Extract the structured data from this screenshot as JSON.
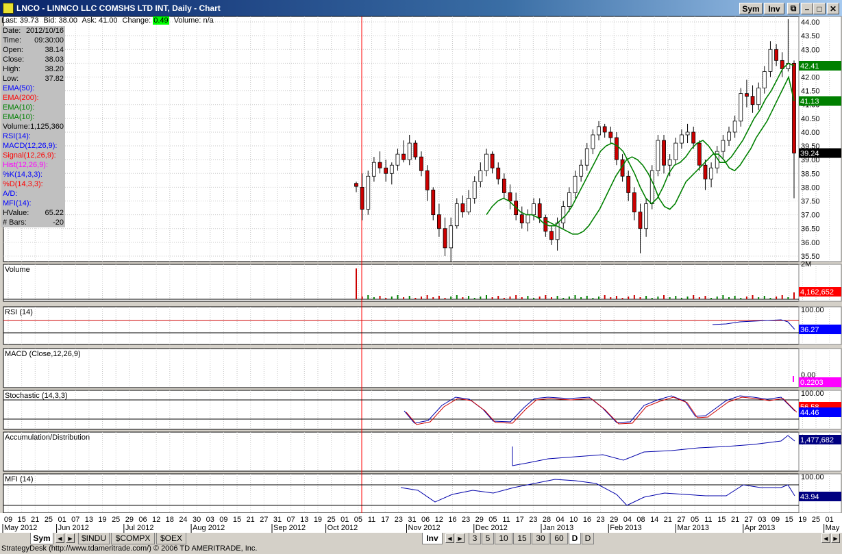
{
  "window": {
    "title": "LNCO - LINNCO LLC COMSHS LTD INT, Daily - Chart",
    "sym_btn": "Sym",
    "inv_btn": "Inv"
  },
  "quote": {
    "last": "Last: 39.73",
    "bid": "Bid: 38.00",
    "ask": "Ask: 41.00",
    "change_label": "Change:",
    "change_value": "0.49",
    "volume": "Volume: n/a"
  },
  "datapanel": [
    {
      "label": "Date:",
      "value": "2012/10/16",
      "color": "#000000"
    },
    {
      "label": "Time:",
      "value": "09:30:00",
      "color": "#000000"
    },
    {
      "label": "Open:",
      "value": "38.14",
      "color": "#000000"
    },
    {
      "label": "Close:",
      "value": "38.03",
      "color": "#000000"
    },
    {
      "label": "High:",
      "value": "38.20",
      "color": "#000000"
    },
    {
      "label": "Low:",
      "value": "37.82",
      "color": "#000000"
    },
    {
      "label": "EMA(50):",
      "value": "",
      "color": "#0000ff"
    },
    {
      "label": "EMA(200):",
      "value": "",
      "color": "#ff0000"
    },
    {
      "label": "EMA(10):",
      "value": "",
      "color": "#008000"
    },
    {
      "label": "EMA(10):",
      "value": "",
      "color": "#008000"
    },
    {
      "label": "Volume:",
      "value": "1,125,360",
      "color": "#000000"
    },
    {
      "label": "RSI(14):",
      "value": "",
      "color": "#0000ff"
    },
    {
      "label": "MACD(12,26,9):",
      "value": "",
      "color": "#0000ff"
    },
    {
      "label": "Signal(12,26,9):",
      "value": "",
      "color": "#ff0000"
    },
    {
      "label": "Hist(12,26,9):",
      "value": "",
      "color": "#ff00ff"
    },
    {
      "label": "%K(14,3,3):",
      "value": "",
      "color": "#0000ff"
    },
    {
      "label": "%D(14,3,3):",
      "value": "",
      "color": "#ff0000"
    },
    {
      "label": "A/D:",
      "value": "",
      "color": "#0000ff"
    },
    {
      "label": "MFI(14):",
      "value": "",
      "color": "#0000ff"
    },
    {
      "label": "HValue:",
      "value": "65.22",
      "color": "#000000"
    },
    {
      "label": "# Bars:",
      "value": "-20",
      "color": "#000000"
    }
  ],
  "panes": {
    "volume": "Volume",
    "rsi": "RSI (14)",
    "macd": "MACD (Close,12,26,9)",
    "stoch": "Stochastic (14,3,3)",
    "ad": "Accumulation/Distribution",
    "mfi": "MFI (14)"
  },
  "price_axis": {
    "ticks": [
      "44.00",
      "43.50",
      "43.00",
      "42.50",
      "42.00",
      "41.50",
      "41.00",
      "40.50",
      "40.00",
      "39.50",
      "39.00",
      "38.50",
      "38.00",
      "37.50",
      "37.00",
      "36.50",
      "36.00",
      "35.50"
    ]
  },
  "badges": {
    "ema_fast": "42.41",
    "ema_slow": "41.13",
    "last_price": "39.24",
    "volume": "4,162,652",
    "volume_top": "2M",
    "rsi_top": "100.00",
    "rsi": "36.27",
    "macd_zero": "0.00",
    "macd": "0.2203",
    "stoch_top": "100.00",
    "stoch_k": "56.58",
    "stoch_d": "44.46",
    "ad": "1,477,682",
    "mfi_top": "100.00",
    "mfi": "43.94"
  },
  "colors": {
    "up": "#ffffff",
    "down": "#cc0000",
    "ema": "#008000",
    "cursor": "#ff0000",
    "line_blue": "#0000aa",
    "line_red": "#cc0000",
    "badge_green": "#008000",
    "badge_black": "#000000",
    "badge_red": "#ff0000",
    "badge_blue": "#0000ff",
    "badge_magenta": "#ff00ff",
    "badge_darkblue": "#000080"
  },
  "date_axis": {
    "days": [
      "09",
      "15",
      "21",
      "25",
      "01",
      "07",
      "13",
      "19",
      "25",
      "29",
      "06",
      "12",
      "18",
      "24",
      "30",
      "03",
      "09",
      "15",
      "21",
      "27",
      "31",
      "07",
      "13",
      "19",
      "25",
      "01",
      "05",
      "11",
      "17",
      "23",
      "31",
      "06",
      "12",
      "16",
      "23",
      "29",
      "05",
      "11",
      "17",
      "23",
      "28",
      "04",
      "10",
      "16",
      "23",
      "29",
      "04",
      "08",
      "14",
      "21",
      "27",
      "05",
      "11",
      "15",
      "21",
      "27",
      "03",
      "09",
      "15",
      "19",
      "25",
      "01"
    ],
    "months": [
      {
        "label": "May 2012",
        "day_index": 0
      },
      {
        "label": "Jun 2012",
        "day_index": 4
      },
      {
        "label": "Jul 2012",
        "day_index": 9
      },
      {
        "label": "Aug 2012",
        "day_index": 14
      },
      {
        "label": "Sep 2012",
        "day_index": 20
      },
      {
        "label": "Oct 2012",
        "day_index": 24
      },
      {
        "label": "Nov 2012",
        "day_index": 30
      },
      {
        "label": "Dec 2012",
        "day_index": 35
      },
      {
        "label": "Jan 2013",
        "day_index": 40
      },
      {
        "label": "Feb 2013",
        "day_index": 45
      },
      {
        "label": "Mar 2013",
        "day_index": 50
      },
      {
        "label": "Apr 2013",
        "day_index": 55
      },
      {
        "label": "May 2013",
        "day_index": 61
      }
    ]
  },
  "bottom_tabs": {
    "sym": "Sym",
    "symbols": [
      "$INDU",
      "$COMPX",
      "$OEX"
    ],
    "inv": "Inv",
    "intervals": [
      "3",
      "5",
      "10",
      "15",
      "30",
      "60",
      "D",
      "D"
    ]
  },
  "status": "StrategyDesk (http://www.tdameritrade.com/) © 2006 TD AMERITRADE, Inc.",
  "chart_data": {
    "type": "candlestick",
    "title": "LNCO - LINNCO LLC COMSHS LTD INT, Daily - Chart",
    "x_range": [
      "2012-10-16",
      "2013-05-01"
    ],
    "ylim": [
      35.3,
      44.2
    ],
    "series": [
      {
        "name": "EMA(10)",
        "values_start_index": 22
      },
      {
        "name": "EMA(10)",
        "values_start_index": 32
      }
    ],
    "ohlc": [
      [
        38.14,
        38.2,
        37.82,
        38.03
      ],
      [
        38.0,
        38.5,
        36.8,
        37.2
      ],
      [
        37.2,
        38.6,
        37.0,
        38.4
      ],
      [
        38.4,
        39.1,
        38.2,
        38.9
      ],
      [
        38.9,
        39.3,
        38.5,
        38.7
      ],
      [
        38.7,
        39.0,
        38.2,
        38.5
      ],
      [
        38.5,
        38.9,
        38.1,
        38.8
      ],
      [
        38.8,
        39.4,
        38.6,
        39.2
      ],
      [
        39.2,
        39.7,
        38.9,
        39.0
      ],
      [
        39.0,
        39.9,
        38.8,
        39.6
      ],
      [
        39.6,
        39.7,
        39.0,
        39.1
      ],
      [
        39.1,
        39.3,
        38.4,
        38.6
      ],
      [
        38.6,
        38.8,
        37.5,
        37.9
      ],
      [
        37.9,
        38.0,
        36.8,
        37.0
      ],
      [
        37.0,
        37.4,
        36.2,
        36.5
      ],
      [
        36.5,
        36.9,
        35.5,
        35.8
      ],
      [
        35.8,
        36.9,
        35.3,
        36.6
      ],
      [
        36.6,
        37.6,
        36.5,
        37.4
      ],
      [
        37.4,
        37.7,
        36.9,
        37.1
      ],
      [
        37.1,
        37.9,
        37.0,
        37.6
      ],
      [
        37.6,
        38.4,
        37.4,
        38.2
      ],
      [
        38.2,
        38.9,
        38.0,
        38.6
      ],
      [
        38.6,
        39.4,
        38.4,
        39.2
      ],
      [
        39.2,
        39.3,
        38.5,
        38.7
      ],
      [
        38.7,
        38.9,
        38.1,
        38.3
      ],
      [
        38.3,
        38.5,
        37.6,
        37.8
      ],
      [
        37.8,
        38.1,
        37.2,
        37.5
      ],
      [
        37.5,
        37.8,
        36.8,
        37.0
      ],
      [
        37.0,
        37.3,
        36.5,
        36.7
      ],
      [
        36.7,
        37.2,
        36.4,
        37.0
      ],
      [
        37.0,
        37.6,
        36.8,
        37.4
      ],
      [
        37.4,
        37.6,
        36.7,
        36.9
      ],
      [
        36.9,
        37.0,
        36.2,
        36.4
      ],
      [
        36.4,
        36.6,
        35.9,
        36.1
      ],
      [
        36.1,
        36.9,
        35.7,
        36.7
      ],
      [
        36.7,
        37.5,
        36.5,
        37.3
      ],
      [
        37.3,
        38.0,
        37.1,
        37.8
      ],
      [
        37.8,
        38.6,
        37.6,
        38.4
      ],
      [
        38.4,
        39.0,
        38.2,
        38.8
      ],
      [
        38.8,
        39.6,
        38.6,
        39.4
      ],
      [
        39.4,
        40.1,
        39.2,
        39.9
      ],
      [
        39.9,
        40.4,
        39.7,
        40.2
      ],
      [
        40.2,
        40.3,
        39.8,
        40.0
      ],
      [
        40.0,
        40.2,
        39.6,
        39.8
      ],
      [
        39.8,
        40.0,
        38.8,
        39.0
      ],
      [
        39.0,
        39.2,
        38.2,
        38.4
      ],
      [
        38.4,
        38.6,
        37.5,
        37.8
      ],
      [
        37.8,
        38.0,
        36.8,
        37.1
      ],
      [
        37.1,
        37.4,
        35.6,
        36.5
      ],
      [
        36.5,
        37.6,
        36.2,
        37.4
      ],
      [
        37.4,
        38.8,
        37.2,
        38.6
      ],
      [
        38.6,
        39.9,
        38.4,
        39.7
      ],
      [
        39.7,
        39.9,
        38.5,
        38.8
      ],
      [
        38.8,
        39.2,
        38.4,
        39.0
      ],
      [
        39.0,
        39.8,
        38.8,
        39.6
      ],
      [
        39.6,
        40.1,
        39.4,
        39.9
      ],
      [
        39.9,
        40.3,
        39.6,
        40.0
      ],
      [
        40.0,
        40.2,
        39.4,
        39.6
      ],
      [
        39.6,
        39.7,
        38.6,
        38.8
      ],
      [
        38.8,
        39.0,
        37.9,
        38.3
      ],
      [
        38.3,
        38.9,
        38.0,
        38.7
      ],
      [
        38.7,
        39.5,
        38.5,
        39.3
      ],
      [
        39.3,
        39.9,
        39.0,
        39.7
      ],
      [
        39.7,
        40.2,
        39.5,
        40.0
      ],
      [
        40.0,
        40.6,
        39.8,
        40.4
      ],
      [
        40.4,
        41.6,
        40.2,
        41.4
      ],
      [
        41.4,
        41.9,
        40.9,
        41.3
      ],
      [
        41.3,
        41.7,
        40.7,
        41.0
      ],
      [
        41.0,
        41.8,
        40.8,
        41.6
      ],
      [
        41.6,
        42.4,
        41.4,
        42.2
      ],
      [
        42.2,
        43.3,
        42.0,
        43.0
      ],
      [
        43.0,
        43.2,
        42.4,
        42.6
      ],
      [
        42.6,
        42.9,
        42.0,
        42.3
      ],
      [
        42.3,
        44.1,
        42.2,
        42.5
      ],
      [
        42.5,
        42.6,
        37.6,
        39.24
      ]
    ],
    "ema_fast": [
      37.0,
      37.3,
      37.5,
      37.6,
      37.5,
      37.3,
      37.1,
      37.0,
      37.0,
      36.9,
      36.7,
      36.6,
      36.6,
      36.8,
      37.0,
      37.3,
      37.7,
      38.1,
      38.5,
      38.9,
      39.3,
      39.5,
      39.6,
      39.5,
      39.3,
      38.9,
      38.5,
      38.0,
      37.6,
      37.4,
      37.6,
      38.0,
      38.5,
      38.8,
      38.9,
      39.1,
      39.4,
      39.6,
      39.7,
      39.5,
      39.2,
      38.9,
      38.9,
      39.1,
      39.4,
      39.7,
      40.1,
      40.5,
      40.8,
      41.2,
      41.5,
      41.9,
      42.3,
      42.5,
      42.41
    ],
    "ema_slow": [
      36.8,
      36.7,
      36.6,
      36.5,
      36.4,
      36.3,
      36.3,
      36.4,
      36.6,
      36.9,
      37.2,
      37.6,
      38.0,
      38.4,
      38.7,
      39.0,
      39.1,
      39.0,
      38.8,
      38.5,
      38.1,
      37.6,
      37.3,
      37.2,
      37.4,
      37.8,
      38.2,
      38.4,
      38.6,
      38.8,
      39.0,
      39.2,
      39.2,
      39.0,
      38.7,
      38.6,
      38.8,
      39.1,
      39.4,
      39.8,
      40.1,
      40.4,
      40.8,
      41.2,
      41.6,
      42.0,
      41.13
    ]
  }
}
